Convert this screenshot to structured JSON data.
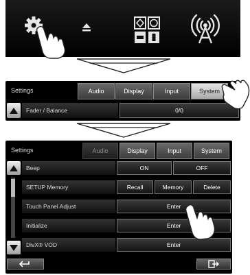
{
  "top_icons": [
    {
      "name": "settings",
      "icon": "gear-icon"
    },
    {
      "name": "eject",
      "icon": "eject-icon"
    },
    {
      "name": "source",
      "icon": "source-grid-icon"
    },
    {
      "name": "wireless",
      "icon": "wireless-antenna-icon"
    }
  ],
  "panel1": {
    "title": "Settings",
    "tabs": [
      "Audio",
      "Display",
      "Input",
      "System"
    ],
    "row": {
      "label": "Fader / Balance",
      "value": "0/0"
    }
  },
  "panel2": {
    "title": "Settings",
    "tabs": [
      "Audio",
      "Display",
      "Input",
      "System"
    ],
    "rows": [
      {
        "label": "Beep",
        "buttons": [
          "ON",
          "OFF"
        ]
      },
      {
        "label": "SETUP Memory",
        "buttons": [
          "Recall",
          "Memory",
          "Delete"
        ]
      },
      {
        "label": "Touch Panel Adjust",
        "buttons": [
          "Enter"
        ]
      },
      {
        "label": "Initialize",
        "buttons": [
          "Enter"
        ]
      },
      {
        "label": "DivX® VOD",
        "buttons": [
          "Enter"
        ]
      }
    ]
  },
  "colors": {
    "selected_tab": "#d0d0d0",
    "panel_bg": "#000000",
    "topbar_bg": "#111111"
  }
}
